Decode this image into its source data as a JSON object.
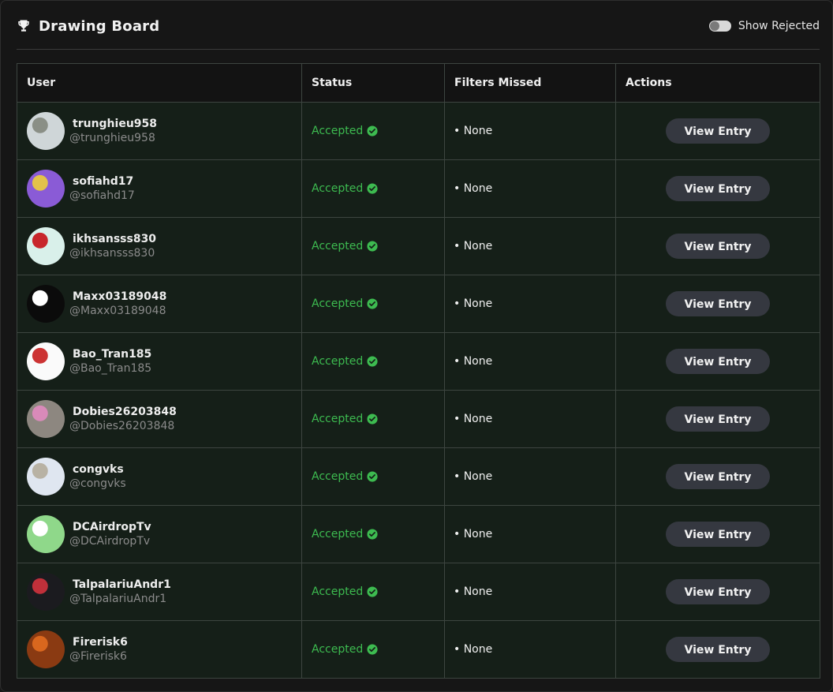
{
  "header": {
    "title": "Drawing Board",
    "trophy_icon": "trophy-icon",
    "toggle_label": "Show Rejected",
    "toggle_on": false
  },
  "table": {
    "columns": [
      "User",
      "Status",
      "Filters Missed",
      "Actions"
    ],
    "rows": [
      {
        "name": "trunghieu958",
        "handle": "@trunghieu958",
        "status": "Accepted",
        "filters": "• None",
        "action": "View Entry",
        "avatar_colors": [
          "#cfd6d8",
          "#8a8f86"
        ]
      },
      {
        "name": "sofiahd17",
        "handle": "@sofiahd17",
        "status": "Accepted",
        "filters": "• None",
        "action": "View Entry",
        "avatar_colors": [
          "#8a5bd6",
          "#e3c24a"
        ]
      },
      {
        "name": "ikhsansss830",
        "handle": "@ikhsansss830",
        "status": "Accepted",
        "filters": "• None",
        "action": "View Entry",
        "avatar_colors": [
          "#d9f0ea",
          "#c8262b"
        ]
      },
      {
        "name": "Maxx03189048",
        "handle": "@Maxx03189048",
        "status": "Accepted",
        "filters": "• None",
        "action": "View Entry",
        "avatar_colors": [
          "#0b0b0b",
          "#ffffff"
        ]
      },
      {
        "name": "Bao_Tran185",
        "handle": "@Bao_Tran185",
        "status": "Accepted",
        "filters": "• None",
        "action": "View Entry",
        "avatar_colors": [
          "#fafafa",
          "#cc3333"
        ]
      },
      {
        "name": "Dobies26203848",
        "handle": "@Dobies26203848",
        "status": "Accepted",
        "filters": "• None",
        "action": "View Entry",
        "avatar_colors": [
          "#8d8780",
          "#d98ab9"
        ]
      },
      {
        "name": "congvks",
        "handle": "@congvks",
        "status": "Accepted",
        "filters": "• None",
        "action": "View Entry",
        "avatar_colors": [
          "#dfe6f0",
          "#b8b2a4"
        ]
      },
      {
        "name": "DCAirdropTv",
        "handle": "@DCAirdropTv",
        "status": "Accepted",
        "filters": "• None",
        "action": "View Entry",
        "avatar_colors": [
          "#8fd88a",
          "#ffffff"
        ]
      },
      {
        "name": "TalpalariuAndr1",
        "handle": "@TalpalariuAndr1",
        "status": "Accepted",
        "filters": "• None",
        "action": "View Entry",
        "avatar_colors": [
          "#1b1b1f",
          "#c0303a"
        ]
      },
      {
        "name": "Firerisk6",
        "handle": "@Firerisk6",
        "status": "Accepted",
        "filters": "• None",
        "action": "View Entry",
        "avatar_colors": [
          "#8a3a12",
          "#d9671e"
        ]
      }
    ]
  },
  "colors": {
    "accepted": "#3dbb50",
    "row_bg": "#151f18",
    "button_bg": "#353840"
  }
}
